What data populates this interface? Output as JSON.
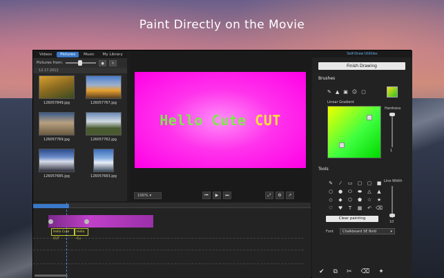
{
  "headline": "Paint Directly on the Movie",
  "tabs": [
    {
      "label": "Videos"
    },
    {
      "label": "Pictures"
    },
    {
      "label": "Music"
    },
    {
      "label": "My Library"
    }
  ],
  "pictures_from_label": "Pictures from:",
  "date_header": "12.17.2012",
  "thumbnails": [
    {
      "caption": "126057849.jpg"
    },
    {
      "caption": "126057767.jpg"
    },
    {
      "caption": "126057769.jpg"
    },
    {
      "caption": "126057762.jpg"
    },
    {
      "caption": "126057685.jpg"
    },
    {
      "caption": "126057683.jpg"
    }
  ],
  "canvas_text": [
    {
      "text": "Hello ",
      "color": "#7ee84a"
    },
    {
      "text": "Cute ",
      "color": "#7ee84a"
    },
    {
      "text": "CUT",
      "color": "#f7e23a"
    }
  ],
  "zoom": "100%",
  "right_panel": {
    "header": "Self-Draw Utilities",
    "finish_button": "Finish Drawing",
    "brushes_label": "Brushes",
    "gradient_label": "Linear Gradient",
    "hardness_label": "Hardness",
    "hardness_value": "1",
    "tools_label": "Tools",
    "line_width_label": "Line Width",
    "line_width_value": "10",
    "clear_button": "Clear painting",
    "font_label": "Font",
    "font_value": "Chalkboard SE Bold"
  },
  "timeline": {
    "clip_labels": [
      "Hello Cute CUT",
      "Hello Cu"
    ]
  }
}
